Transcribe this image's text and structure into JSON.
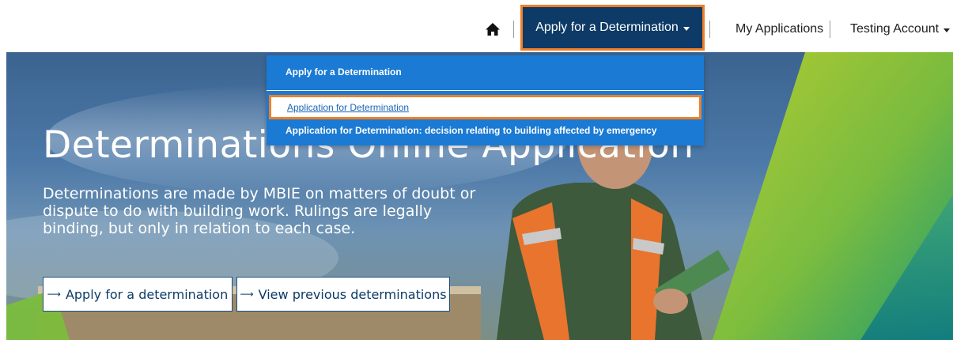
{
  "nav": {
    "apply_label": "Apply for a Determination",
    "my_applications_label": "My Applications",
    "account_label": "Testing Account"
  },
  "dropdown": {
    "header": "Apply for a Determination",
    "items": [
      {
        "label": "Application for Determination",
        "selected": true
      },
      {
        "label": "Application for Determination: decision relating to building affected by emergency",
        "selected": false
      }
    ]
  },
  "hero": {
    "title": "Determinations Online Application",
    "description": "Determinations are made by MBIE on matters of doubt or dispute to do with building work. Rulings are legally binding, but only in relation to each case.",
    "buttons": {
      "apply": "Apply for a determination",
      "view": "View previous determinations"
    }
  },
  "colors": {
    "nav_active_bg": "#0d3a66",
    "highlight_border": "#f07f25",
    "dropdown_bg": "#1a7ad4",
    "link_text": "#1a66b8"
  }
}
